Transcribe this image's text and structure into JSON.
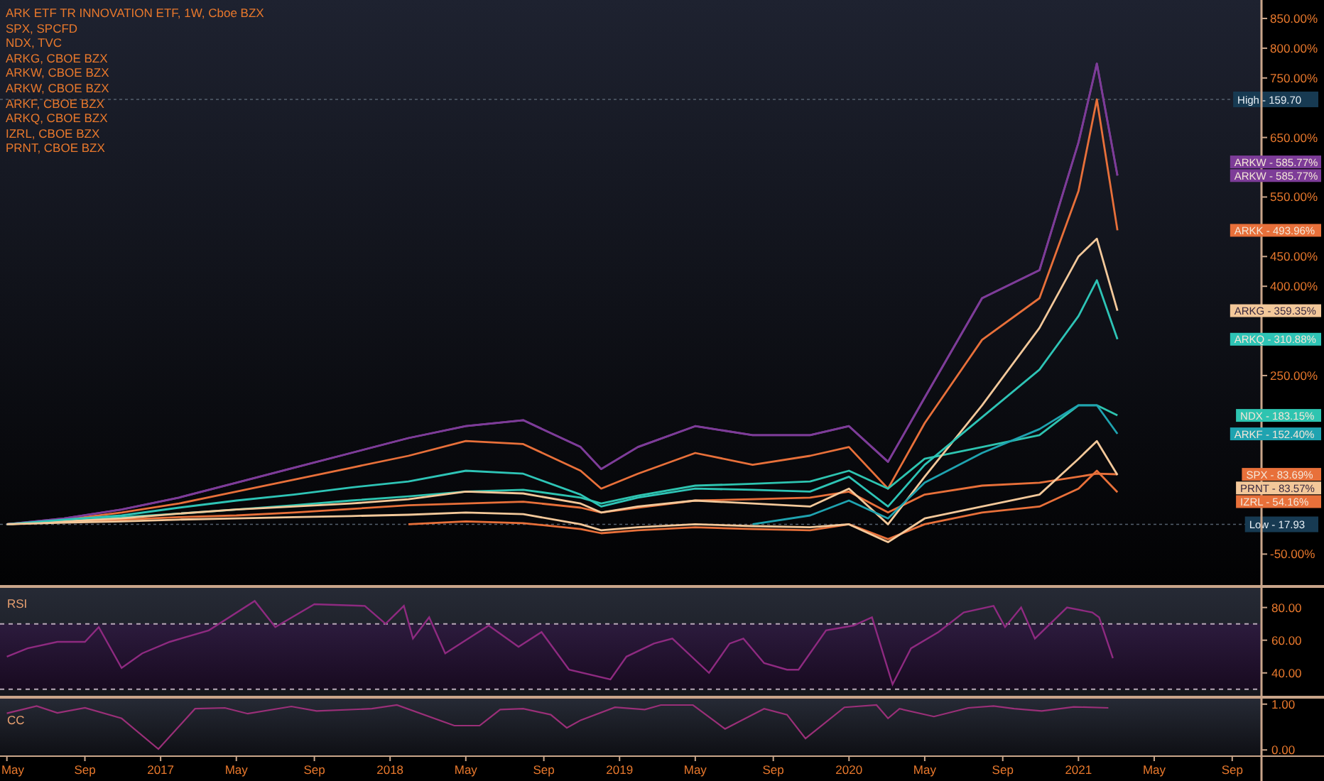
{
  "main": {
    "price_lines": [
      {
        "kind": "high",
        "text": "High - 159.70"
      },
      {
        "kind": "low",
        "text": "Low - 17.93"
      }
    ],
    "value_labels": [
      {
        "text": "ARKW - 585.77%",
        "color": "#7d3c98"
      },
      {
        "text": "ARKW - 585.77%",
        "color": "#7d3c98"
      },
      {
        "text": "ARKK - 493.96%",
        "color": "#e8703a"
      },
      {
        "text": "ARKG - 359.35%",
        "color": "#f3c89a"
      },
      {
        "text": "ARKQ - 310.88%",
        "color": "#2ec4b6"
      },
      {
        "text": "NDX - 183.15%",
        "color": "#2ec4b0"
      },
      {
        "text": "ARKF - 152.40%",
        "color": "#1fa3b0"
      },
      {
        "text": "SPX - 83.69%",
        "color": "#e8703a"
      },
      {
        "text": "PRNT - 83.57%",
        "color": "#f3c89a"
      },
      {
        "text": "IZRL - 54.16%",
        "color": "#e8703a"
      }
    ],
    "chart_data": {
      "type": "line",
      "x": [
        2016.33,
        2016.58,
        2016.83,
        2017.08,
        2017.33,
        2017.58,
        2017.83,
        2018.08,
        2018.33,
        2018.58,
        2018.83,
        2018.92,
        2019.08,
        2019.33,
        2019.58,
        2019.83,
        2020.0,
        2020.17,
        2020.33,
        2020.58,
        2020.83,
        2021.0,
        2021.08,
        2021.17
      ],
      "xlim": [
        2016.3,
        2022.07
      ],
      "ylim": [
        -102,
        881
      ],
      "yticks": [
        {
          "value": 850,
          "label": "850.00%"
        },
        {
          "value": 800,
          "label": "800.00%"
        },
        {
          "value": 750,
          "label": "750.00%"
        },
        {
          "value": 650,
          "label": "650.00%"
        },
        {
          "value": 550,
          "label": "550.00%"
        },
        {
          "value": 450,
          "label": "450.00%"
        },
        {
          "value": 400,
          "label": "400.00%"
        },
        {
          "value": 250,
          "label": "250.00%"
        },
        {
          "value": -50,
          "label": "-50.00%"
        }
      ],
      "series": [
        {
          "name": "ARK ETF TR INNOVATION ETF, 1W, Cboe BZX",
          "color": "#e8703a",
          "values": [
            0,
            8,
            20,
            35,
            55,
            75,
            95,
            115,
            140,
            135,
            90,
            60,
            85,
            120,
            100,
            115,
            130,
            60,
            170,
            310,
            380,
            560,
            714,
            494
          ]
        },
        {
          "name": "SPX, SPCFD",
          "color": "#e8703a",
          "values": [
            0,
            4,
            8,
            12,
            15,
            20,
            26,
            32,
            35,
            38,
            28,
            20,
            28,
            40,
            42,
            45,
            55,
            20,
            50,
            65,
            70,
            80,
            85,
            84
          ]
        },
        {
          "name": "NDX, TVC",
          "color": "#2ec4b0",
          "values": [
            0,
            5,
            12,
            18,
            25,
            32,
            40,
            47,
            55,
            58,
            45,
            35,
            48,
            65,
            68,
            72,
            90,
            60,
            110,
            130,
            150,
            200,
            200,
            183
          ]
        },
        {
          "name": "ARKG, CBOE BZX",
          "color": "#f3c89a",
          "values": [
            0,
            5,
            10,
            18,
            25,
            30,
            35,
            42,
            55,
            52,
            35,
            20,
            30,
            40,
            35,
            30,
            60,
            0,
            80,
            200,
            330,
            450,
            480,
            359
          ]
        },
        {
          "name": "ARKW, CBOE BZX",
          "color": "#7d3c98",
          "values": [
            0,
            10,
            25,
            45,
            70,
            95,
            120,
            145,
            165,
            175,
            130,
            93,
            130,
            165,
            150,
            150,
            165,
            105,
            213,
            380,
            427,
            642,
            774,
            586
          ]
        },
        {
          "name": "ARKW, CBOE BZX",
          "color": "#7d3c98",
          "values": [
            0,
            10,
            25,
            45,
            70,
            95,
            120,
            145,
            165,
            175,
            130,
            93,
            130,
            165,
            150,
            150,
            165,
            105,
            213,
            380,
            427,
            642,
            774,
            586
          ]
        },
        {
          "name": "ARKF, CBOE BZX",
          "color": "#1fa3b0",
          "values": [
            null,
            null,
            null,
            null,
            null,
            null,
            null,
            null,
            null,
            null,
            null,
            null,
            null,
            null,
            0,
            15,
            40,
            10,
            70,
            120,
            160,
            200,
            200,
            152
          ]
        },
        {
          "name": "ARKQ, CBOE BZX",
          "color": "#2ec4b6",
          "values": [
            0,
            8,
            15,
            28,
            40,
            50,
            62,
            72,
            90,
            85,
            50,
            30,
            45,
            60,
            58,
            55,
            80,
            30,
            100,
            180,
            260,
            350,
            410,
            311
          ]
        },
        {
          "name": "IZRL, CBOE BZX",
          "color": "#e8703a",
          "values": [
            null,
            null,
            null,
            null,
            null,
            null,
            null,
            0,
            5,
            2,
            -8,
            -15,
            -10,
            -5,
            -8,
            -10,
            0,
            -25,
            0,
            20,
            30,
            60,
            90,
            54
          ]
        },
        {
          "name": "PRNT, CBOE BZX",
          "color": "#f3c89a",
          "values": [
            0,
            3,
            5,
            8,
            10,
            12,
            14,
            16,
            20,
            17,
            0,
            -10,
            -5,
            0,
            -3,
            -5,
            0,
            -30,
            10,
            30,
            50,
            110,
            140,
            83
          ]
        }
      ]
    }
  },
  "rsi": {
    "chart_data": {
      "type": "line",
      "x": [
        2016.33,
        2016.42,
        2016.55,
        2016.67,
        2016.73,
        2016.83,
        2016.92,
        2017.04,
        2017.21,
        2017.41,
        2017.5,
        2017.67,
        2017.89,
        2017.98,
        2018.06,
        2018.1,
        2018.17,
        2018.24,
        2018.43,
        2018.56,
        2018.66,
        2018.78,
        2018.96,
        2019.03,
        2019.15,
        2019.23,
        2019.39,
        2019.48,
        2019.54,
        2019.63,
        2019.73,
        2019.78,
        2019.9,
        2020.02,
        2020.1,
        2020.19,
        2020.27,
        2020.39,
        2020.5,
        2020.63,
        2020.68,
        2020.75,
        2020.81,
        2020.95,
        2021.06,
        2021.09,
        2021.15
      ],
      "xlim": [
        2016.3,
        2022.07
      ],
      "ylim": [
        26,
        92
      ],
      "yticks": [
        {
          "value": 80,
          "label": "80.00"
        },
        {
          "value": 60,
          "label": "60.00"
        },
        {
          "value": 40,
          "label": "40.00"
        }
      ],
      "series": [
        {
          "name": "RSI",
          "color": "#8e2a80",
          "values": [
            50,
            55,
            59,
            59,
            68,
            43,
            52,
            59,
            66,
            84,
            68,
            82,
            81,
            70,
            81,
            61,
            74,
            52,
            69,
            56,
            65,
            42,
            36,
            50,
            58,
            61,
            40,
            58,
            61,
            46,
            42,
            42,
            66,
            69,
            74,
            33,
            55,
            65,
            77,
            81,
            68,
            80,
            61,
            80,
            77,
            74,
            49
          ]
        }
      ]
    }
  },
  "cc": {
    "chart_data": {
      "type": "line",
      "x": [
        2016.33,
        2016.46,
        2016.55,
        2016.67,
        2016.83,
        2016.99,
        2017.15,
        2017.28,
        2017.38,
        2017.57,
        2017.68,
        2017.92,
        2018.03,
        2018.28,
        2018.39,
        2018.48,
        2018.58,
        2018.7,
        2018.77,
        2018.83,
        2018.98,
        2019.11,
        2019.18,
        2019.32,
        2019.46,
        2019.63,
        2019.73,
        2019.81,
        2019.98,
        2020.12,
        2020.17,
        2020.22,
        2020.37,
        2020.52,
        2020.63,
        2020.72,
        2020.84,
        2020.98,
        2021.13
      ],
      "xlim": [
        2016.3,
        2022.07
      ],
      "ylim": [
        -0.12,
        1.12
      ],
      "xticks": [
        {
          "value": 2016.33,
          "label": "May"
        },
        {
          "value": 2016.67,
          "label": "Sep"
        },
        {
          "value": 2017,
          "label": "2017"
        },
        {
          "value": 2017.33,
          "label": "May"
        },
        {
          "value": 2017.67,
          "label": "Sep"
        },
        {
          "value": 2018,
          "label": "2018"
        },
        {
          "value": 2018.33,
          "label": "May"
        },
        {
          "value": 2018.67,
          "label": "Sep"
        },
        {
          "value": 2019,
          "label": "2019"
        },
        {
          "value": 2019.33,
          "label": "May"
        },
        {
          "value": 2019.67,
          "label": "Sep"
        },
        {
          "value": 2020,
          "label": "2020"
        },
        {
          "value": 2020.33,
          "label": "May"
        },
        {
          "value": 2020.67,
          "label": "Sep"
        },
        {
          "value": 2021,
          "label": "2021"
        },
        {
          "value": 2021.33,
          "label": "May"
        },
        {
          "value": 2021.67,
          "label": "Sep"
        }
      ],
      "yticks": [
        {
          "value": 1,
          "label": "1.00"
        },
        {
          "value": 0,
          "label": "0.00"
        }
      ],
      "series": [
        {
          "name": "CC",
          "color": "#9a2f78",
          "values": [
            0.8,
            0.96,
            0.81,
            0.92,
            0.69,
            0.02,
            0.9,
            0.92,
            0.79,
            0.95,
            0.85,
            0.9,
            0.98,
            0.53,
            0.53,
            0.88,
            0.9,
            0.77,
            0.48,
            0.65,
            0.93,
            0.88,
            0.98,
            0.98,
            0.46,
            0.9,
            0.77,
            0.25,
            0.93,
            0.98,
            0.69,
            0.9,
            0.73,
            0.92,
            0.96,
            0.9,
            0.85,
            0.94,
            0.92
          ]
        }
      ]
    }
  }
}
